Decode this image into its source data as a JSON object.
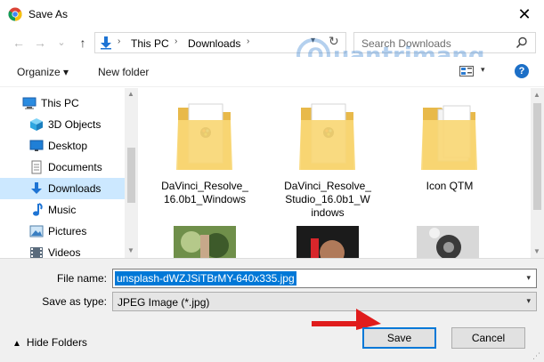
{
  "window": {
    "title": "Save As",
    "close_glyph": "✕",
    "app_icon": "chrome-icon"
  },
  "nav": {
    "back_glyph": "←",
    "forward_glyph": "→",
    "recent_glyph": "⌄",
    "up_glyph": "↑",
    "sep_glyph": "›",
    "path": [
      "This PC",
      "Downloads"
    ],
    "search_placeholder": "Search Downloads"
  },
  "toolbar": {
    "organize_label": "Organize ▾",
    "new_folder_label": "New folder",
    "help_glyph": "?"
  },
  "sidebar": {
    "items": [
      {
        "label": "This PC",
        "icon": "computer-icon",
        "selected": false
      },
      {
        "label": "3D Objects",
        "icon": "cube-icon",
        "selected": false
      },
      {
        "label": "Desktop",
        "icon": "desktop-icon",
        "selected": false
      },
      {
        "label": "Documents",
        "icon": "document-icon",
        "selected": false
      },
      {
        "label": "Downloads",
        "icon": "download-arrow-icon",
        "selected": true
      },
      {
        "label": "Music",
        "icon": "music-note-icon",
        "selected": false
      },
      {
        "label": "Pictures",
        "icon": "picture-icon",
        "selected": false
      },
      {
        "label": "Videos",
        "icon": "video-icon",
        "selected": false
      }
    ]
  },
  "files": [
    {
      "name_line1": "DaVinci_Resolve_",
      "name_line2": "16.0b1_Windows",
      "name_line3": "",
      "icon": "folder-icon"
    },
    {
      "name_line1": "DaVinci_Resolve_",
      "name_line2": "Studio_16.0b1_W",
      "name_line3": "indows",
      "icon": "folder-icon"
    },
    {
      "name_line1": "Icon QTM",
      "name_line2": "",
      "name_line3": "",
      "icon": "folder-icon"
    }
  ],
  "form": {
    "file_name_label": "File name:",
    "file_name_value": "unsplash-dWZJSiTBrMY-640x335.jpg",
    "save_type_label": "Save as type:",
    "save_type_value": "JPEG Image (*.jpg)",
    "hide_folders_label": "Hide Folders",
    "save_label": "Save",
    "cancel_label": "Cancel"
  },
  "colors": {
    "selection": "#0078d7",
    "sidebar_selected": "#cce8ff",
    "folder": "#f8d775",
    "arrow": "#e01c1c"
  }
}
